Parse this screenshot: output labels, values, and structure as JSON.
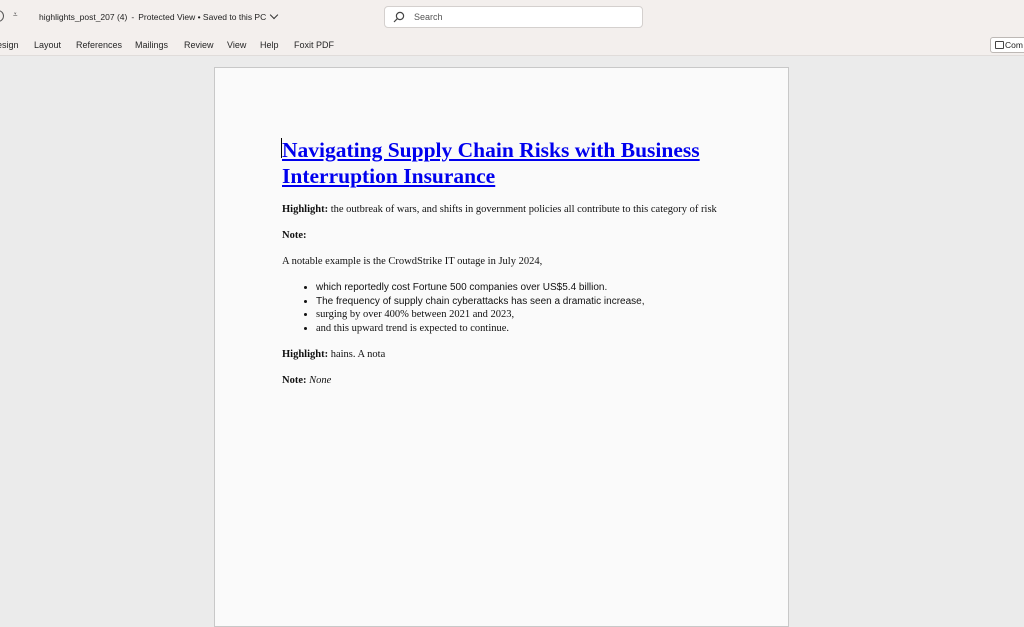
{
  "titlebar": {
    "file_name": "highlights_post_207 (4)",
    "separator": "-",
    "status": "Protected View • Saved to this PC",
    "search_placeholder": "Search"
  },
  "ribbon": {
    "tabs": [
      "esign",
      "Layout",
      "References",
      "Mailings",
      "Review",
      "View",
      "Help",
      "Foxit PDF"
    ],
    "comments_button": "Com"
  },
  "document": {
    "title": "Navigating Supply Chain Risks with Business Interruption Insurance",
    "para1": {
      "label": "Highlight:",
      "text": " the outbreak of wars, and shifts in government policies all contribute to this category of risk"
    },
    "para2": {
      "label": "Note:",
      "text": ""
    },
    "para3": "A notable example is the CrowdStrike IT outage in July 2024,",
    "bullets": [
      "which reportedly cost Fortune 500 companies over US$5.4 billion.",
      "The frequency of supply chain cyberattacks has seen a dramatic increase,",
      "surging by over 400% between 2021 and 2023,",
      "and this upward trend is expected to continue."
    ],
    "para4": {
      "label": "Highlight:",
      "text": " hains. A nota"
    },
    "para5": {
      "label": "Note:",
      "text": "None"
    }
  }
}
